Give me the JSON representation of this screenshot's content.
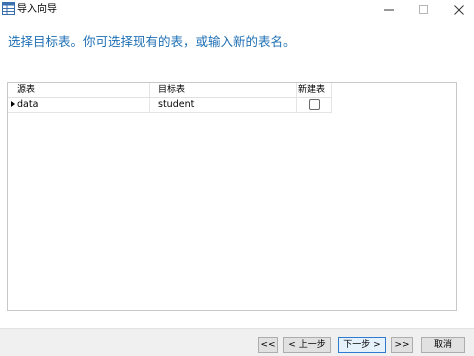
{
  "window": {
    "title": "导入向导",
    "icon": "table-import-icon"
  },
  "instruction": "选择目标表。你可选择现有的表，或输入新的表名。",
  "table": {
    "columns": [
      "源表",
      "目标表",
      "新建表"
    ],
    "rows": [
      {
        "source": "data",
        "target": "student",
        "new_table": false
      }
    ]
  },
  "buttons": {
    "first": "<<",
    "prev": "< 上一步",
    "next": "下一步 >",
    "last": ">>",
    "cancel": "取消"
  },
  "colors": {
    "instruction_text": "#1d6fb5",
    "primary_button_border": "#2f7bd0",
    "footer_bg": "#f0f0f0"
  }
}
